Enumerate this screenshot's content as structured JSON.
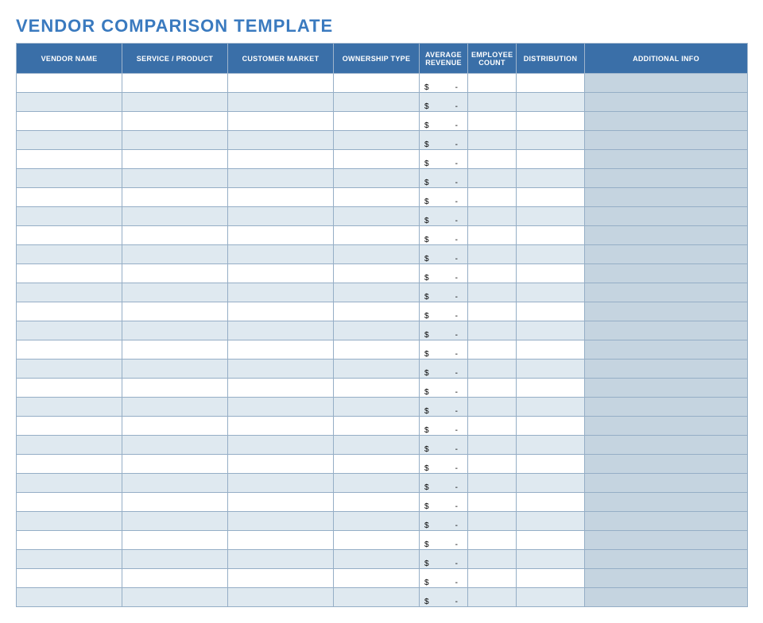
{
  "title": "VENDOR COMPARISON TEMPLATE",
  "columns": [
    "VENDOR NAME",
    "SERVICE / PRODUCT",
    "CUSTOMER MARKET",
    "OWNERSHIP TYPE",
    "AVERAGE REVENUE",
    "EMPLOYEE COUNT",
    "DISTRIBUTION",
    "ADDITIONAL INFO"
  ],
  "currency_symbol": "$",
  "dash": "-",
  "row_count": 28,
  "rows": [
    {
      "vendor_name": "",
      "service_product": "",
      "customer_market": "",
      "ownership_type": "",
      "average_revenue": "-",
      "employee_count": "",
      "distribution": "",
      "additional_info": ""
    },
    {
      "vendor_name": "",
      "service_product": "",
      "customer_market": "",
      "ownership_type": "",
      "average_revenue": "-",
      "employee_count": "",
      "distribution": "",
      "additional_info": ""
    },
    {
      "vendor_name": "",
      "service_product": "",
      "customer_market": "",
      "ownership_type": "",
      "average_revenue": "-",
      "employee_count": "",
      "distribution": "",
      "additional_info": ""
    },
    {
      "vendor_name": "",
      "service_product": "",
      "customer_market": "",
      "ownership_type": "",
      "average_revenue": "-",
      "employee_count": "",
      "distribution": "",
      "additional_info": ""
    },
    {
      "vendor_name": "",
      "service_product": "",
      "customer_market": "",
      "ownership_type": "",
      "average_revenue": "-",
      "employee_count": "",
      "distribution": "",
      "additional_info": ""
    },
    {
      "vendor_name": "",
      "service_product": "",
      "customer_market": "",
      "ownership_type": "",
      "average_revenue": "-",
      "employee_count": "",
      "distribution": "",
      "additional_info": ""
    },
    {
      "vendor_name": "",
      "service_product": "",
      "customer_market": "",
      "ownership_type": "",
      "average_revenue": "-",
      "employee_count": "",
      "distribution": "",
      "additional_info": ""
    },
    {
      "vendor_name": "",
      "service_product": "",
      "customer_market": "",
      "ownership_type": "",
      "average_revenue": "-",
      "employee_count": "",
      "distribution": "",
      "additional_info": ""
    },
    {
      "vendor_name": "",
      "service_product": "",
      "customer_market": "",
      "ownership_type": "",
      "average_revenue": "-",
      "employee_count": "",
      "distribution": "",
      "additional_info": ""
    },
    {
      "vendor_name": "",
      "service_product": "",
      "customer_market": "",
      "ownership_type": "",
      "average_revenue": "-",
      "employee_count": "",
      "distribution": "",
      "additional_info": ""
    },
    {
      "vendor_name": "",
      "service_product": "",
      "customer_market": "",
      "ownership_type": "",
      "average_revenue": "-",
      "employee_count": "",
      "distribution": "",
      "additional_info": ""
    },
    {
      "vendor_name": "",
      "service_product": "",
      "customer_market": "",
      "ownership_type": "",
      "average_revenue": "-",
      "employee_count": "",
      "distribution": "",
      "additional_info": ""
    },
    {
      "vendor_name": "",
      "service_product": "",
      "customer_market": "",
      "ownership_type": "",
      "average_revenue": "-",
      "employee_count": "",
      "distribution": "",
      "additional_info": ""
    },
    {
      "vendor_name": "",
      "service_product": "",
      "customer_market": "",
      "ownership_type": "",
      "average_revenue": "-",
      "employee_count": "",
      "distribution": "",
      "additional_info": ""
    },
    {
      "vendor_name": "",
      "service_product": "",
      "customer_market": "",
      "ownership_type": "",
      "average_revenue": "-",
      "employee_count": "",
      "distribution": "",
      "additional_info": ""
    },
    {
      "vendor_name": "",
      "service_product": "",
      "customer_market": "",
      "ownership_type": "",
      "average_revenue": "-",
      "employee_count": "",
      "distribution": "",
      "additional_info": ""
    },
    {
      "vendor_name": "",
      "service_product": "",
      "customer_market": "",
      "ownership_type": "",
      "average_revenue": "-",
      "employee_count": "",
      "distribution": "",
      "additional_info": ""
    },
    {
      "vendor_name": "",
      "service_product": "",
      "customer_market": "",
      "ownership_type": "",
      "average_revenue": "-",
      "employee_count": "",
      "distribution": "",
      "additional_info": ""
    },
    {
      "vendor_name": "",
      "service_product": "",
      "customer_market": "",
      "ownership_type": "",
      "average_revenue": "-",
      "employee_count": "",
      "distribution": "",
      "additional_info": ""
    },
    {
      "vendor_name": "",
      "service_product": "",
      "customer_market": "",
      "ownership_type": "",
      "average_revenue": "-",
      "employee_count": "",
      "distribution": "",
      "additional_info": ""
    },
    {
      "vendor_name": "",
      "service_product": "",
      "customer_market": "",
      "ownership_type": "",
      "average_revenue": "-",
      "employee_count": "",
      "distribution": "",
      "additional_info": ""
    },
    {
      "vendor_name": "",
      "service_product": "",
      "customer_market": "",
      "ownership_type": "",
      "average_revenue": "-",
      "employee_count": "",
      "distribution": "",
      "additional_info": ""
    },
    {
      "vendor_name": "",
      "service_product": "",
      "customer_market": "",
      "ownership_type": "",
      "average_revenue": "-",
      "employee_count": "",
      "distribution": "",
      "additional_info": ""
    },
    {
      "vendor_name": "",
      "service_product": "",
      "customer_market": "",
      "ownership_type": "",
      "average_revenue": "-",
      "employee_count": "",
      "distribution": "",
      "additional_info": ""
    },
    {
      "vendor_name": "",
      "service_product": "",
      "customer_market": "",
      "ownership_type": "",
      "average_revenue": "-",
      "employee_count": "",
      "distribution": "",
      "additional_info": ""
    },
    {
      "vendor_name": "",
      "service_product": "",
      "customer_market": "",
      "ownership_type": "",
      "average_revenue": "-",
      "employee_count": "",
      "distribution": "",
      "additional_info": ""
    },
    {
      "vendor_name": "",
      "service_product": "",
      "customer_market": "",
      "ownership_type": "",
      "average_revenue": "-",
      "employee_count": "",
      "distribution": "",
      "additional_info": ""
    },
    {
      "vendor_name": "",
      "service_product": "",
      "customer_market": "",
      "ownership_type": "",
      "average_revenue": "-",
      "employee_count": "",
      "distribution": "",
      "additional_info": ""
    }
  ]
}
